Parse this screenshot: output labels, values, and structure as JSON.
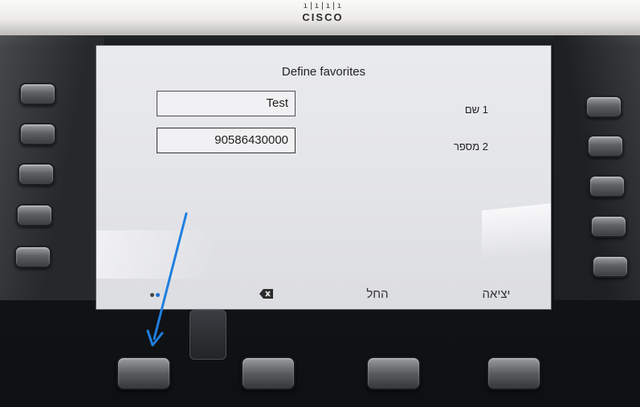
{
  "brand": {
    "logo_bars": "ı|ı|ı|ı",
    "logo_text": "CISCO"
  },
  "screen": {
    "title": "Define favorites",
    "fields": [
      {
        "value": "Test",
        "label": "1  שם"
      },
      {
        "value": "90586430000",
        "label": "2  מספר"
      }
    ],
    "softkeys": [
      {
        "label": "",
        "icon": "more-dots-icon"
      },
      {
        "label": "",
        "icon": "backspace-icon"
      },
      {
        "label": "החל"
      },
      {
        "label": "יציאה"
      }
    ]
  },
  "colors": {
    "accent": "#1d6fd1",
    "arrow": "#1f7fe0",
    "screen": "#e6e7eb"
  }
}
